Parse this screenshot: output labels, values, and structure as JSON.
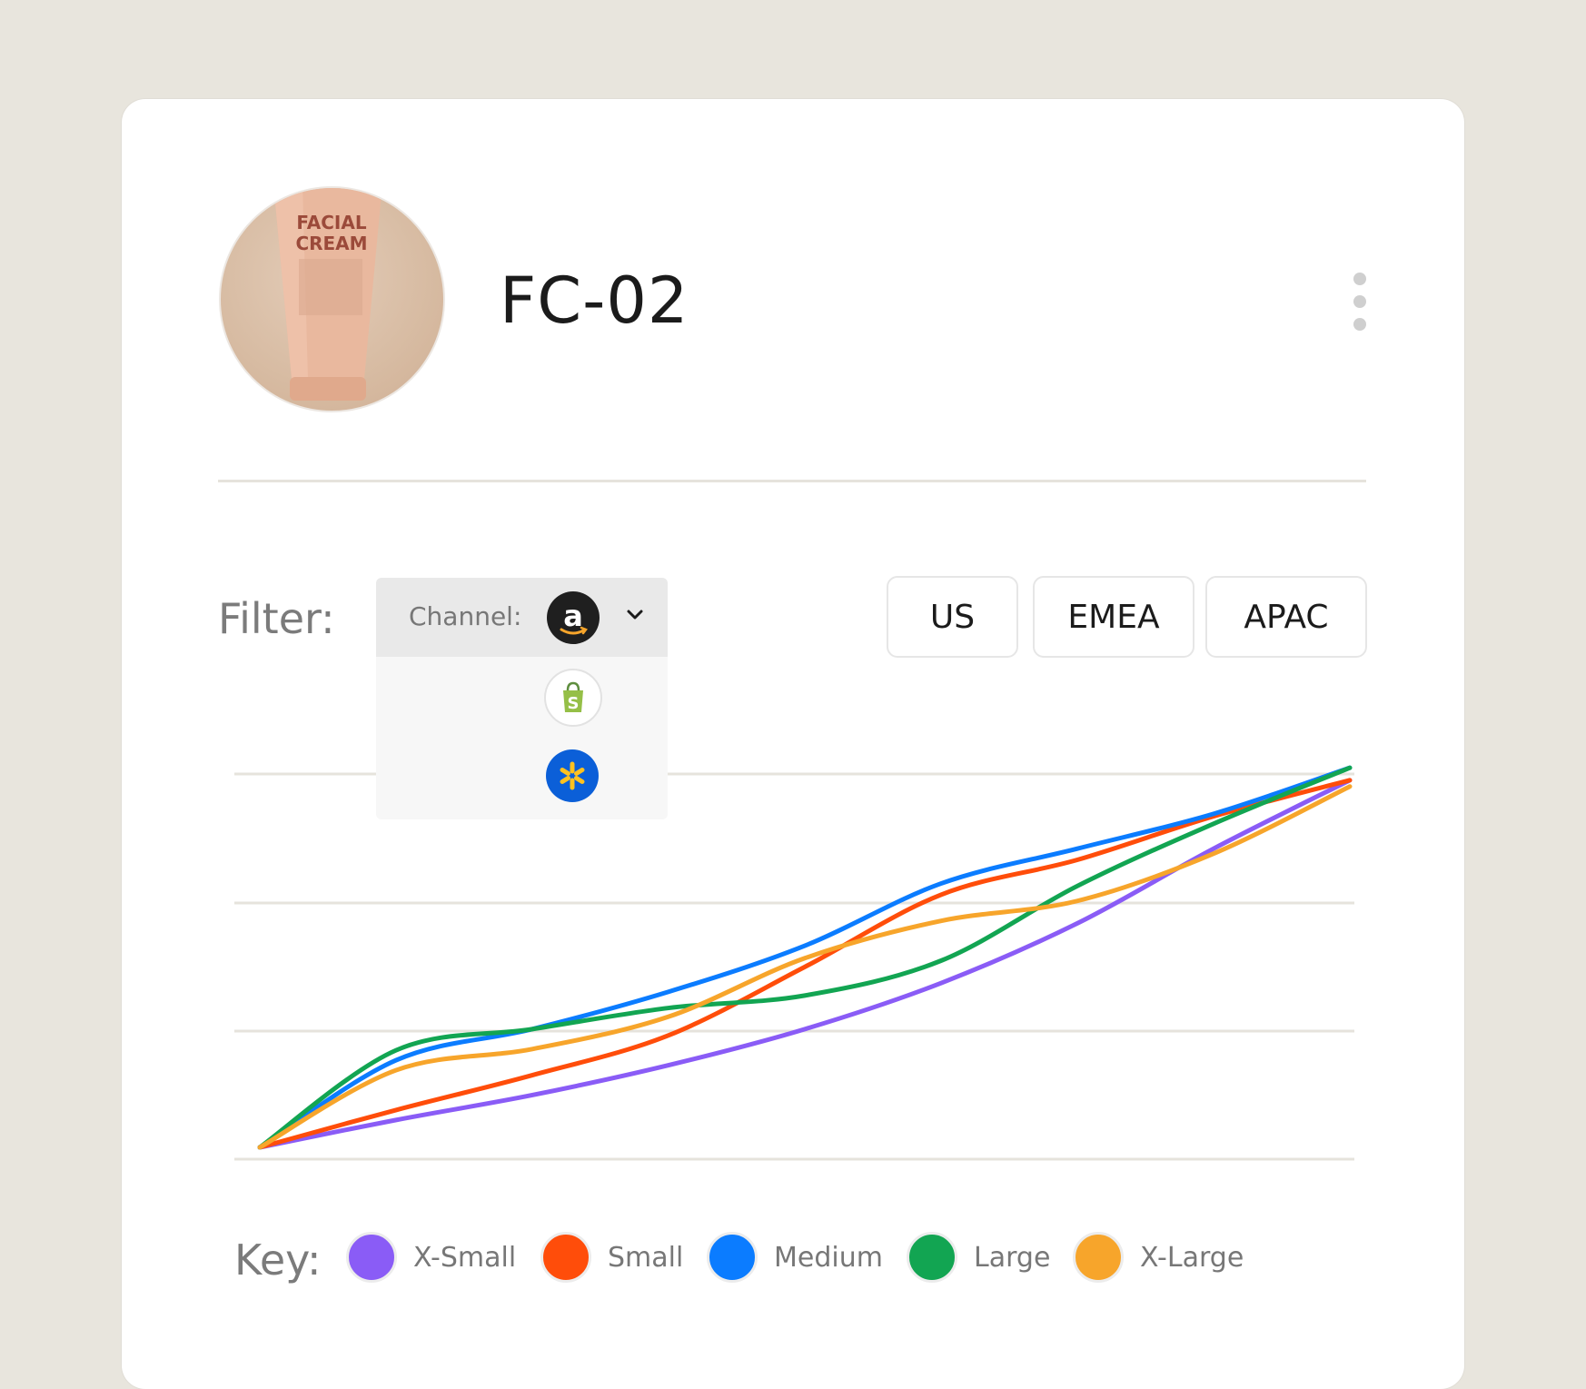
{
  "product": {
    "id": "FC-02",
    "image_label_line1": "FACIAL",
    "image_label_line2": "CREAM"
  },
  "menu": {
    "icon": "kebab-vertical-icon"
  },
  "filter": {
    "label": "Filter:",
    "channel": {
      "label": "Channel:",
      "selected": "amazon",
      "options": [
        "amazon",
        "shopify",
        "walmart"
      ]
    },
    "regions": [
      "US",
      "EMEA",
      "APAC"
    ]
  },
  "key": {
    "label": "Key:"
  },
  "colors": {
    "x_small": "#8a5cf6",
    "small": "#ff4d0a",
    "medium": "#0b7cff",
    "large": "#12a552",
    "x_large": "#f7a52b"
  },
  "chart_data": {
    "type": "line",
    "title": "",
    "xlabel": "",
    "ylabel": "",
    "x": [
      0,
      1,
      2,
      3,
      4,
      5,
      6,
      7,
      8
    ],
    "xlim": [
      0,
      8.6
    ],
    "ylim": [
      0,
      3
    ],
    "grid": true,
    "legend_position": "bottom",
    "series": [
      {
        "name": "X-Small",
        "color": "#8a5cf6",
        "values": [
          0.0,
          0.22,
          0.42,
          0.66,
          0.95,
          1.32,
          1.8,
          2.4,
          2.95
        ]
      },
      {
        "name": "Small",
        "color": "#ff4d0a",
        "values": [
          0.0,
          0.3,
          0.58,
          0.9,
          1.45,
          2.03,
          2.31,
          2.66,
          2.95
        ]
      },
      {
        "name": "Medium",
        "color": "#0b7cff",
        "values": [
          0.0,
          0.7,
          0.95,
          1.25,
          1.62,
          2.12,
          2.4,
          2.68,
          3.05
        ]
      },
      {
        "name": "Large",
        "color": "#12a552",
        "values": [
          0.0,
          0.78,
          0.95,
          1.12,
          1.22,
          1.5,
          2.1,
          2.6,
          3.05
        ]
      },
      {
        "name": "X-Large",
        "color": "#f7a52b",
        "values": [
          0.0,
          0.62,
          0.79,
          1.05,
          1.52,
          1.82,
          1.98,
          2.36,
          2.9
        ]
      }
    ]
  }
}
